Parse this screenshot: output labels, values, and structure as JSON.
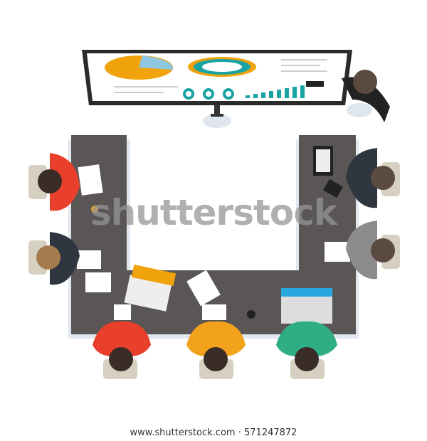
{
  "watermark": "shutterstock",
  "footer": {
    "site": "www.shutterstock.com",
    "separator": "·",
    "image_number": "571247872"
  },
  "colors": {
    "table": "#5a5656",
    "monitor_frame": "#2b2b2b",
    "accent_orange": "#f0a30a",
    "accent_teal": "#1aa3a3",
    "shirt_red": "#e8402a",
    "shirt_orange": "#f3a21c",
    "shirt_green": "#2fae86",
    "suit_dark": "#2f3640",
    "suit_gray": "#8c8c8c"
  }
}
